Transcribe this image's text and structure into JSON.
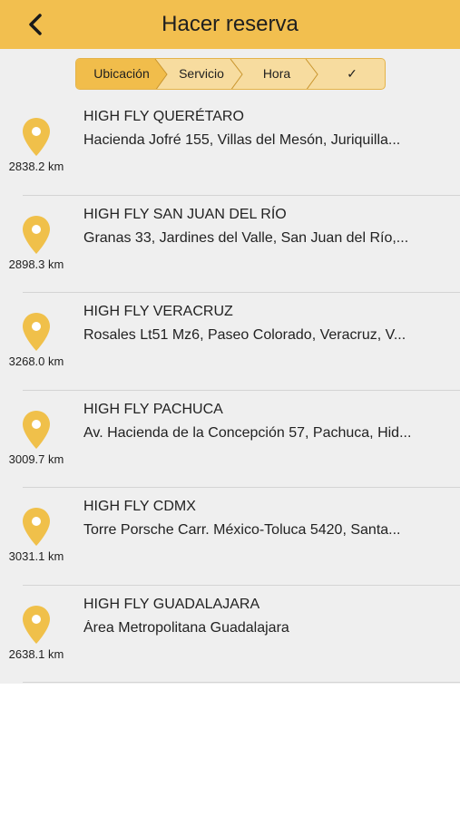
{
  "header": {
    "title": "Hacer reserva",
    "back_icon": "chevron-left-icon"
  },
  "stepper": {
    "steps": [
      {
        "label": "Ubicación",
        "active": true
      },
      {
        "label": "Servicio",
        "active": false
      },
      {
        "label": "Hora",
        "active": false
      },
      {
        "label": "✓",
        "active": false
      }
    ]
  },
  "colors": {
    "accent": "#f2bf4f",
    "pin": "#f0c04a",
    "background": "#efefef"
  },
  "locations": [
    {
      "name": "HIGH FLY QUERÉTARO",
      "address": " Hacienda Jofré 155, Villas del Mesón, Juriquilla...",
      "distance": "2838.2 km"
    },
    {
      "name": "HIGH FLY SAN JUAN DEL RÍO",
      "address": "Granas 33, Jardines del Valle, San Juan del Río,...",
      "distance": "2898.3 km"
    },
    {
      "name": "HIGH FLY VERACRUZ",
      "address": "Rosales Lt51 Mz6, Paseo Colorado, Veracruz, V...",
      "distance": "3268.0 km"
    },
    {
      "name": "HIGH FLY PACHUCA",
      "address": "Av. Hacienda de la Concepción 57, Pachuca, Hid...",
      "distance": "3009.7 km"
    },
    {
      "name": "HIGH FLY CDMX",
      "address": "Torre Porsche Carr. México-Toluca 5420, Santa...",
      "distance": "3031.1 km"
    },
    {
      "name": "HIGH FLY GUADALAJARA",
      "address": "Área Metropolitana Guadalajara",
      "distance": "2638.1 km"
    }
  ]
}
